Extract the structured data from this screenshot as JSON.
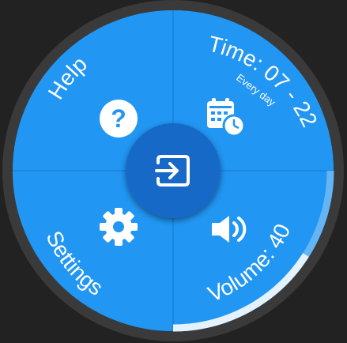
{
  "menu": {
    "help": {
      "label": "Help",
      "icon": "help-circle-icon"
    },
    "time": {
      "label": "Time: 07 - 22",
      "sublabel": "Every day",
      "icon": "calendar-clock-icon"
    },
    "settings": {
      "label": "Settings",
      "icon": "gear-icon"
    },
    "volume": {
      "label": "Volume: 40",
      "icon": "speaker-icon",
      "level_percent": 40
    },
    "center": {
      "icon": "exit-icon"
    }
  },
  "colors": {
    "background": "#222222",
    "bezel": "#3a3a3a",
    "face": "#2196f3",
    "center_button": "#1769c7",
    "divider": "#1c86dc",
    "volume_track": "#64b5f6",
    "volume_fill": "#e3f2fd"
  }
}
